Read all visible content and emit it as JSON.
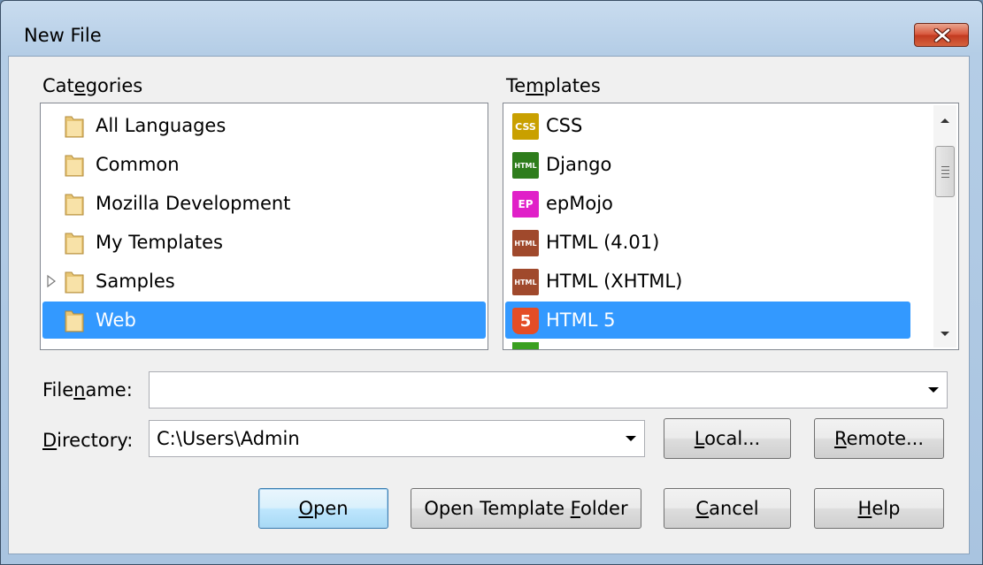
{
  "window": {
    "title": "New File"
  },
  "categories": {
    "label_pre": "Cat",
    "label_ul": "e",
    "label_post": "gories",
    "items": [
      {
        "label": "All Languages",
        "selected": false,
        "expandable": false
      },
      {
        "label": "Common",
        "selected": false,
        "expandable": false
      },
      {
        "label": "Mozilla Development",
        "selected": false,
        "expandable": false
      },
      {
        "label": "My Templates",
        "selected": false,
        "expandable": false
      },
      {
        "label": "Samples",
        "selected": false,
        "expandable": true
      },
      {
        "label": "Web",
        "selected": true,
        "expandable": false
      }
    ]
  },
  "templates": {
    "label_pre": "Te",
    "label_ul": "m",
    "label_post": "plates",
    "items": [
      {
        "label": "CSS",
        "icon": "css-icon",
        "icon_text": "CSS",
        "icon_color": "#c9a000",
        "selected": false
      },
      {
        "label": "Django",
        "icon": "django-html-icon",
        "icon_text": "HTML",
        "icon_color": "#2e7d1c",
        "selected": false
      },
      {
        "label": "epMojo",
        "icon": "epmojo-icon",
        "icon_text": "EP",
        "icon_color": "#e020c8",
        "selected": false
      },
      {
        "label": "HTML (4.01)",
        "icon": "html-icon",
        "icon_text": "HTML",
        "icon_color": "#a0492c",
        "selected": false
      },
      {
        "label": "HTML (XHTML)",
        "icon": "xhtml-icon",
        "icon_text": "HTML",
        "icon_color": "#a0492c",
        "selected": false
      },
      {
        "label": "HTML 5",
        "icon": "html5-icon",
        "icon_text": "5",
        "icon_color": "#e44d26",
        "selected": true
      }
    ]
  },
  "filename": {
    "label_pre": "File",
    "label_ul": "n",
    "label_post": "ame:",
    "value": ""
  },
  "directory": {
    "label_pre": "",
    "label_ul": "D",
    "label_post": "irectory:",
    "value": "C:\\Users\\Admin"
  },
  "buttons": {
    "local": {
      "ul": "L",
      "rest": "ocal..."
    },
    "remote": {
      "ul": "R",
      "rest": "emote..."
    },
    "open": {
      "ul": "O",
      "rest": "pen"
    },
    "open_template_folder": {
      "pre": "Open Template ",
      "ul": "F",
      "rest": "older"
    },
    "cancel": {
      "ul": "C",
      "rest": "ancel"
    },
    "help": {
      "ul": "H",
      "rest": "elp"
    }
  },
  "colors": {
    "selection": "#3399ff",
    "close_button": "#c94a2e"
  }
}
